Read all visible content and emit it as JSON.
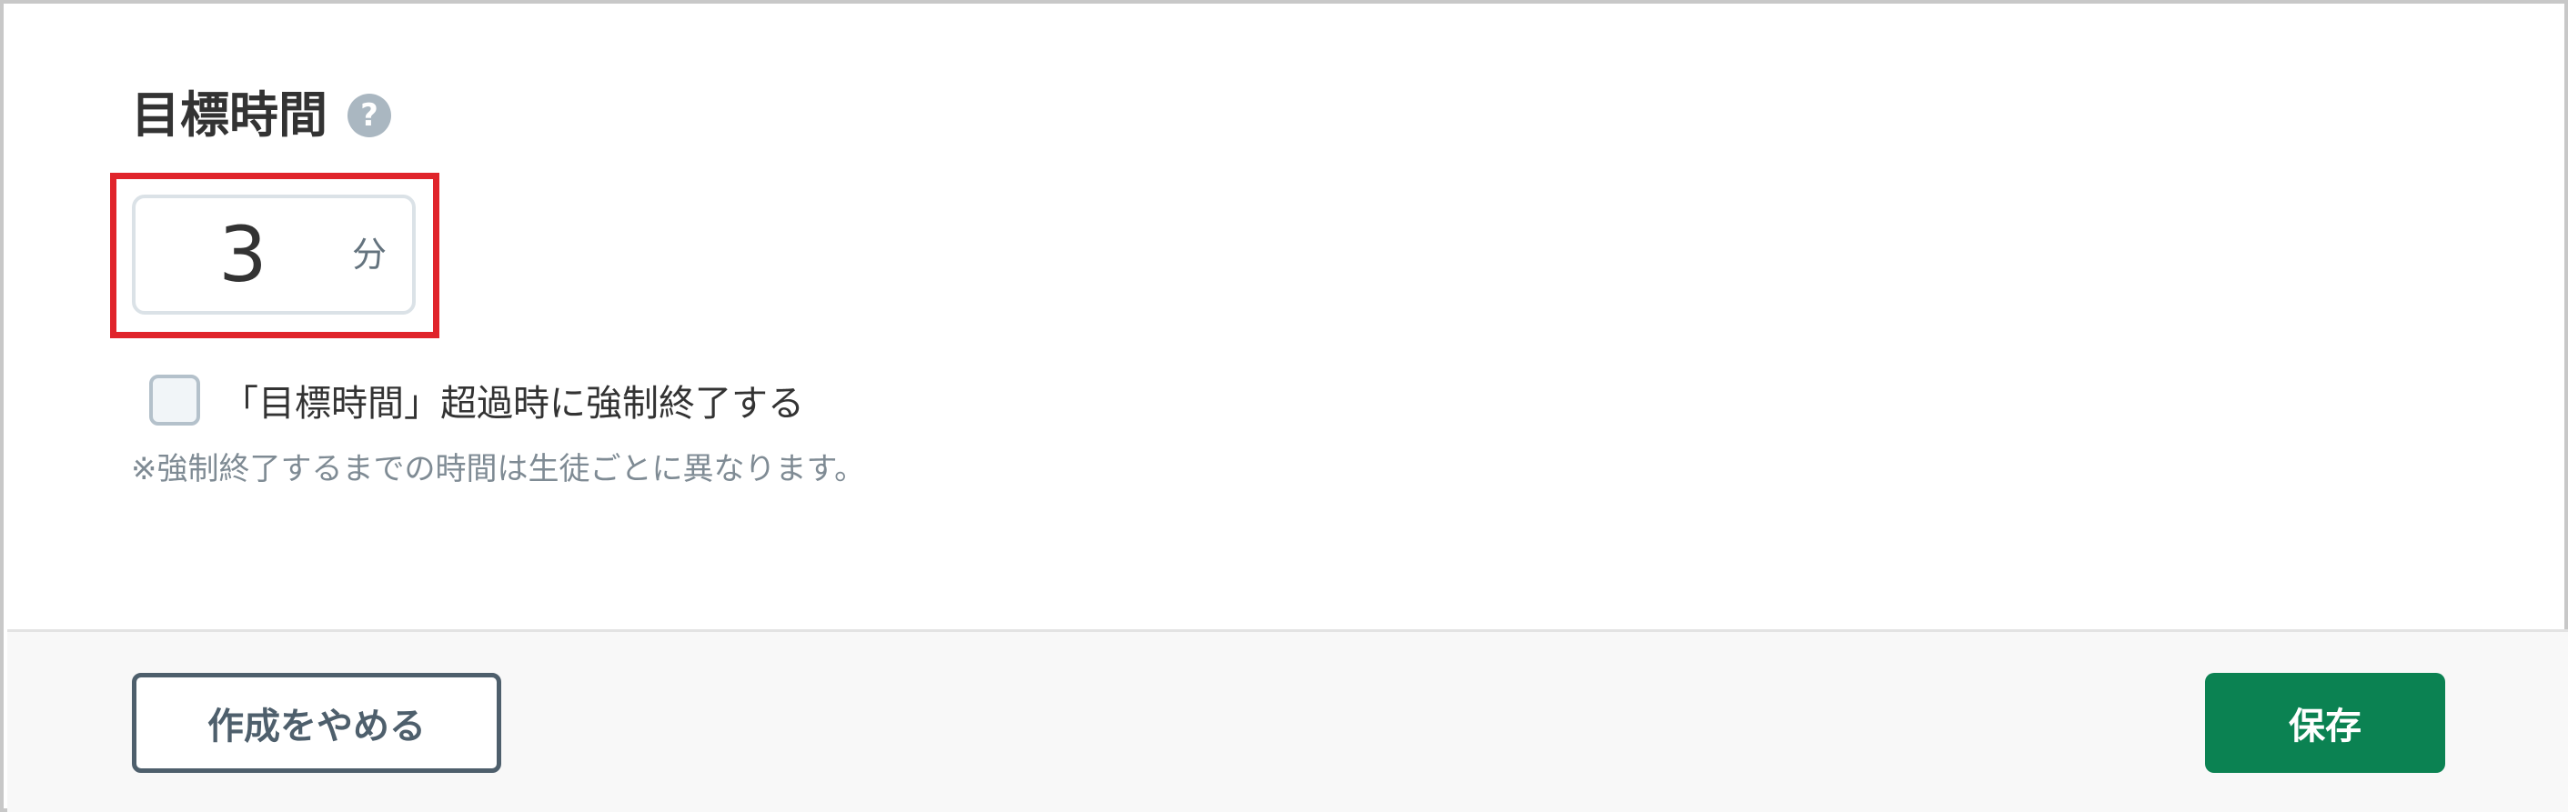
{
  "section": {
    "title": "目標時間",
    "help_icon": "question-circle-icon",
    "help_glyph": "?"
  },
  "duration": {
    "value": "3",
    "unit": "分"
  },
  "force_end": {
    "checked": false,
    "label": "「目標時間」超過時に強制終了する",
    "note": "※強制終了するまでの時間は生徒ごとに異なります。"
  },
  "footer": {
    "cancel_label": "作成をやめる",
    "save_label": "保存"
  },
  "colors": {
    "highlight": "#e0242b",
    "save_button": "#0b8252",
    "cancel_text": "#4e5f6c",
    "help_icon": "#aab7c1"
  }
}
